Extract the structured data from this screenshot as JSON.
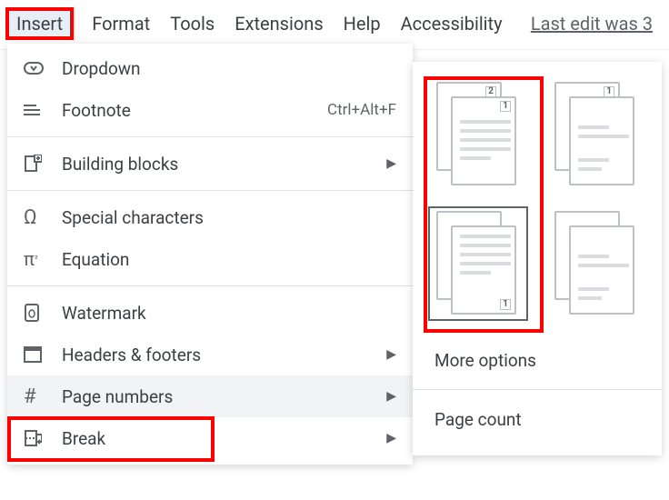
{
  "menubar": {
    "items": [
      "Insert",
      "Format",
      "Tools",
      "Extensions",
      "Help",
      "Accessibility"
    ],
    "last_edit": "Last edit was 3"
  },
  "insert_menu": {
    "dropdown": {
      "label": "Dropdown"
    },
    "footnote": {
      "label": "Footnote",
      "shortcut": "Ctrl+Alt+F"
    },
    "building_blocks": {
      "label": "Building blocks"
    },
    "special_chars": {
      "label": "Special characters"
    },
    "equation": {
      "label": "Equation"
    },
    "watermark": {
      "label": "Watermark"
    },
    "headers_footers": {
      "label": "Headers & footers"
    },
    "page_numbers": {
      "label": "Page numbers"
    },
    "break": {
      "label": "Break"
    }
  },
  "page_numbers_submenu": {
    "more_options": "More options",
    "page_count": "Page count",
    "options": [
      {
        "position": "header-right"
      },
      {
        "position": "header-right-skip-first"
      },
      {
        "position": "footer-right"
      },
      {
        "position": "footer-right-skip-first"
      }
    ]
  },
  "highlights": {
    "menubar_highlight": "Insert",
    "menu_highlight": "Page numbers",
    "submenu_column": 0
  }
}
